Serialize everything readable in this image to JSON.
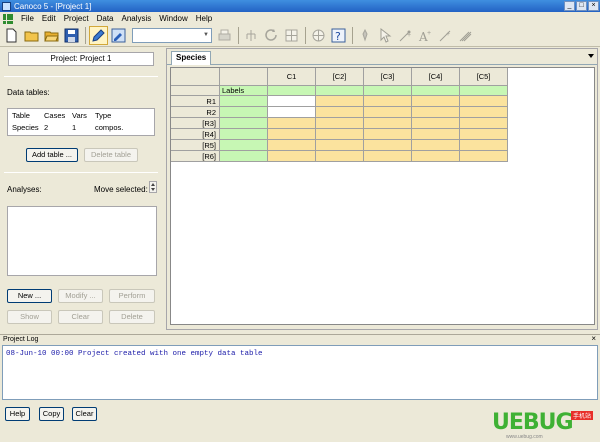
{
  "window": {
    "title": "Canoco 5 - [Project 1]"
  },
  "menu": [
    "File",
    "Edit",
    "Project",
    "Data",
    "Analysis",
    "Window",
    "Help"
  ],
  "toolbar": {
    "left_icons": [
      "new-file-icon",
      "open-folder-icon",
      "open-icon",
      "save-icon",
      "edit-pencil-icon",
      "table-edit-icon",
      "print-icon"
    ],
    "combo_value": "",
    "right_icons": [
      "tree-icon",
      "refresh-icon",
      "grid-icon",
      "globe-icon",
      "help-icon",
      "graph-tool-icon",
      "pointer-icon",
      "add-points-icon",
      "add-text-icon",
      "add-line-icon",
      "hatch-icon"
    ]
  },
  "left": {
    "project_label": "Project: Project 1",
    "data_tables_label": "Data tables:",
    "table_headers": [
      "Table",
      "Cases",
      "Vars",
      "Type"
    ],
    "table_rows": [
      [
        "Species",
        "2",
        "1",
        "compos."
      ]
    ],
    "add_table": "Add table ...",
    "delete_table": "Delete table",
    "analyses_label": "Analyses:",
    "move_selected": "Move selected:",
    "new": "New ...",
    "modify": "Modify ...",
    "perform": "Perform",
    "show": "Show",
    "clear": "Clear",
    "delete": "Delete"
  },
  "sheet": {
    "tab": "Species",
    "columns": [
      "C1",
      "[C2]",
      "[C3]",
      "[C4]",
      "[C5]"
    ],
    "labels_header": "Labels",
    "rows": [
      "R1",
      "R2",
      "[R3]",
      "[R4]",
      "[R5]",
      "[R6]"
    ]
  },
  "log": {
    "title": "Project Log",
    "lines": [
      "08-Jun-10 00:00 Project created with one empty data table"
    ],
    "close": "×"
  },
  "bottom_buttons": {
    "help": "Help",
    "copy": "Copy",
    "clear": "Clear"
  },
  "watermark": {
    "text": "UEBUG",
    "badge": "手机站",
    "url": "www.uebug.com"
  },
  "colors": {
    "labels_green": "#c7f7b4",
    "data_yellow": "#fbe39e",
    "title_blue": "#2362c4"
  }
}
